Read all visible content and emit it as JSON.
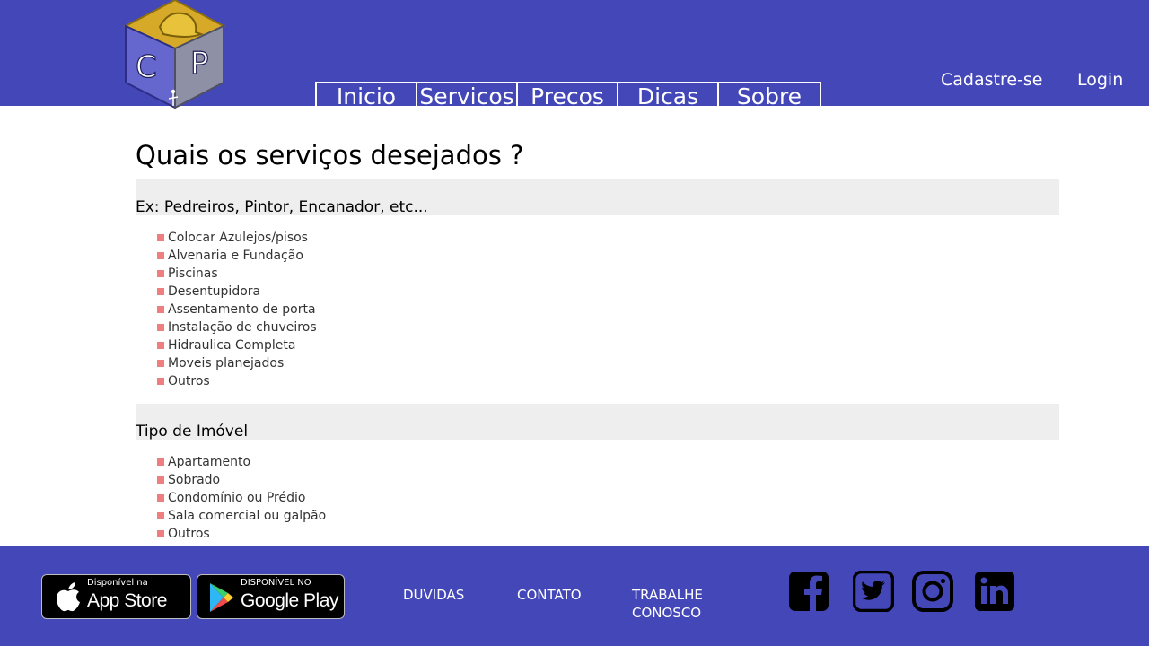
{
  "header": {
    "logo_letters": [
      "C",
      "P"
    ],
    "nav": [
      {
        "label": "Inicio"
      },
      {
        "label": "Servicos"
      },
      {
        "label": "Precos"
      },
      {
        "label": "Dicas"
      },
      {
        "label": "Sobre"
      }
    ],
    "signup_label": "Cadastre-se",
    "login_label": "Login"
  },
  "main": {
    "title": "Quais os serviços desejados ?",
    "services_heading": "Ex: Pedreiros, Pintor, Encanador, etc...",
    "services": [
      "Colocar Azulejos/pisos",
      "Alvenaria e Fundação",
      "Piscinas",
      "Desentupidora",
      "Assentamento de porta",
      "Instalação de chuveiros",
      "Hidraulica Completa",
      "Moveis planejados",
      "Outros"
    ],
    "property_heading": "Tipo de Imóvel",
    "property_types": [
      "Apartamento",
      "Sobrado",
      "Condomínio ou Prédio",
      "Sala comercial ou galpão",
      "Outros"
    ]
  },
  "footer": {
    "appstore": {
      "small": "Disponível na",
      "big": "App Store"
    },
    "googleplay": {
      "small": "DISPONÍVEL NO",
      "big": "Google Play"
    },
    "links": {
      "duvidas": "DUVIDAS",
      "contato": "CONTATO",
      "trabalhe": "TRABALHE\nCONOSCO"
    },
    "social_icons": [
      "facebook-icon",
      "twitter-icon",
      "instagram-icon",
      "linkedin-icon"
    ]
  },
  "colors": {
    "brand_blue": "#4447b8",
    "bullet": "#ef7e7e",
    "section_bg": "#eeeeee",
    "logo_gold": "#d7a928"
  }
}
